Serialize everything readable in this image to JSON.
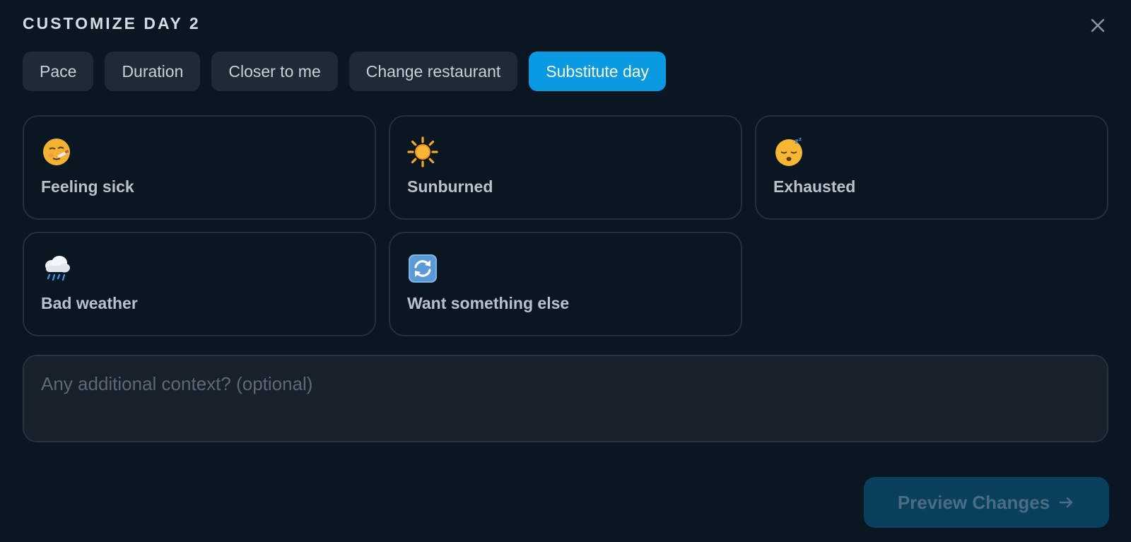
{
  "dialog": {
    "title": "CUSTOMIZE DAY 2",
    "close_icon": "close-icon"
  },
  "tabs": [
    {
      "label": "Pace",
      "active": false
    },
    {
      "label": "Duration",
      "active": false
    },
    {
      "label": "Closer to me",
      "active": false
    },
    {
      "label": "Change restaurant",
      "active": false
    },
    {
      "label": "Substitute day",
      "active": true
    }
  ],
  "reasons": [
    {
      "label": "Feeling sick",
      "icon": "sick-face-icon"
    },
    {
      "label": "Sunburned",
      "icon": "sun-icon"
    },
    {
      "label": "Exhausted",
      "icon": "sleeping-face-icon"
    },
    {
      "label": "Bad weather",
      "icon": "rain-cloud-icon"
    },
    {
      "label": "Want something else",
      "icon": "refresh-arrows-icon"
    }
  ],
  "context_input": {
    "placeholder": "Any additional context? (optional)",
    "value": ""
  },
  "preview_button": {
    "label": "Preview Changes",
    "icon": "arrow-right-icon"
  },
  "colors": {
    "background": "#0a1621",
    "active_tab": "#0a9ae2",
    "preview_button_bg": "#0b3f5e"
  }
}
